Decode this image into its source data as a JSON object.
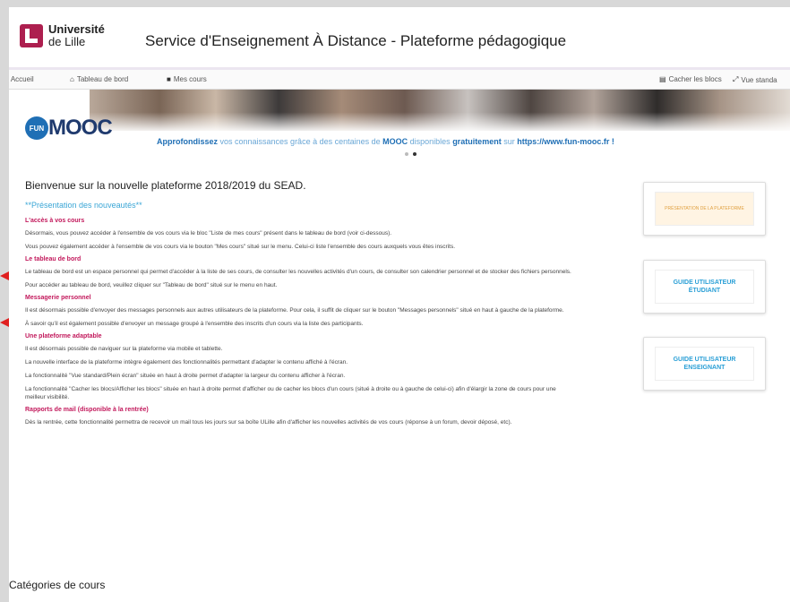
{
  "header": {
    "logo_line1": "Université",
    "logo_line2": "de Lille",
    "title": "Service d'Enseignement À Distance - Plateforme pédagogique",
    "brand_color": "#ad1f4f"
  },
  "nav": {
    "home": "Accueil",
    "dashboard": "Tableau de bord",
    "my_courses": "Mes cours",
    "hide_blocks": "Cacher les blocs",
    "standard_view": "Vue standa"
  },
  "banner": {
    "fun_label": "FUN",
    "mooc_label": "MOOC",
    "tag_bold1": "Approfondissez",
    "tag_text1": " vos connaissances grâce à des centaines de ",
    "tag_bold2": "MOOC",
    "tag_text2": " disponibles ",
    "tag_bold3": "gratuitement",
    "tag_text3": " sur ",
    "tag_link": "https://www.fun-mooc.fr !",
    "slide_count": 2,
    "active_slide": 2
  },
  "main": {
    "welcome": "Bienvenue sur la nouvelle plateforme 2018/2019 du SEAD.",
    "presentation": "**Présentation des nouveautés**",
    "sections": [
      {
        "title": "L'accès à vos cours",
        "paragraphs": [
          "Désormais, vous pouvez accéder à l'ensemble de vos cours via le bloc \"Liste de mes cours\" présent dans le tableau de bord (voir ci-dessous).",
          "Vous pouvez également accéder à l'ensemble de vos cours via le bouton \"Mes cours\" situé sur le menu. Celui-ci liste l'ensemble des cours auxquels vous êtes inscrits."
        ]
      },
      {
        "title": "Le tableau de bord",
        "paragraphs": [
          "Le tableau de bord est un espace personnel qui permet d'accéder à la liste de ses cours, de consulter les nouvelles activités d'un cours, de consulter son calendrier personnel et de stocker des fichiers personnels.",
          "Pour accéder au tableau de bord, veuillez cliquer sur \"Tableau de bord\" situé sur le menu en haut."
        ]
      },
      {
        "title": "Messagerie personnel",
        "paragraphs": [
          "Il est désormais possible d'envoyer des messages personnels aux autres utilisateurs de la plateforme. Pour cela, il suffit de cliquer sur le bouton \"Messages personnels\" situé en haut à gauche de la plateforme.",
          "À savoir qu'il est également possible d'envoyer un message groupé à l'ensemble des inscrits d'un cours via la liste des participants."
        ]
      },
      {
        "title": "Une plateforme adaptable",
        "paragraphs": [
          "Il est désormais possible de naviguer sur la plateforme via mobile et tablette.",
          "La nouvelle interface de la plateforme intègre également des fonctionnalités permettant d'adapter le contenu affiché à l'écran.",
          "La fonctionnalité \"Vue standard/Plein écran\" située en haut à droite permet d'adapter la largeur du contenu afficher à l'écran.",
          "La fonctionnalité \"Cacher les blocs/Afficher les blocs\" située en haut à droite permet d'afficher ou de cacher les blocs d'un cours (situé à droite ou à gauche de celui-ci) afin d'élargir la zone de cours pour une meilleur visibilité."
        ]
      },
      {
        "title": "Rapports de mail (disponible à la rentrée)",
        "paragraphs": [
          "Dès la rentrée, cette fonctionnalité permettra de recevoir un mail tous les jours sur sa boîte ULille afin d'afficher les nouvelles activités de vos cours (réponse à un forum, devoir déposé, etc)."
        ]
      }
    ],
    "categories_title": "Catégories de cours"
  },
  "blocks": {
    "presentation": "PRÉSENTATION DE LA PLATEFORME",
    "guide_student_line1": "GUIDE UTILISATEUR",
    "guide_student_line2": "ÉTUDIANT",
    "guide_teacher_line1": "GUIDE UTILISATEUR",
    "guide_teacher_line2": "ENSEIGNANT"
  }
}
